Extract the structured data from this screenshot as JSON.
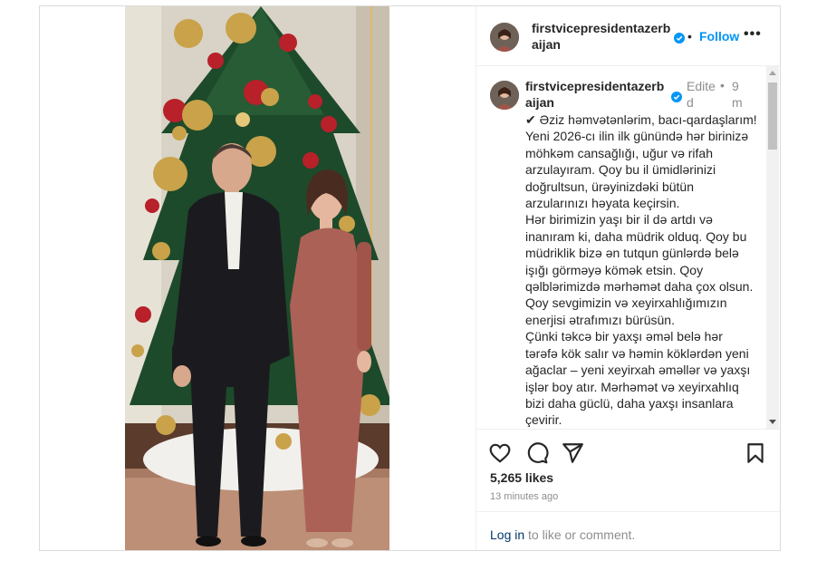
{
  "post": {
    "username": "firstvicepresidentazerbaijan",
    "follow_label": "Follow",
    "header_dot": "•",
    "more_icon": "more-horizontal-icon",
    "caption": {
      "username": "firstvicepresidentazerbaijan",
      "edited": "Edited",
      "dot": "•",
      "time": "9m",
      "text": "✔ Əziz həmvətənlərim, bacı-qardaşlarım!\nYeni 2026-cı ilin ilk günündə hər birinizə möhkəm cansağlığı, uğur və rifah arzulayıram. Qoy bu il ümidlərinizi doğrultsun, ürəyinizdəki bütün arzularınızı həyata keçirsin.\nHər birimizin yaşı bir il də artdı və inanıram ki, daha müdrik olduq. Qoy bu müdriklik bizə ən tutqun günlərdə belə işığı görməyə kömək etsin. Qoy qəlblərimizdə mərhəmət daha çox olsun. Qoy sevgimizin və xeyirxahlığımızın enerjisi ətrafımızı bürüsün.\nÇünki təkcə bir yaxşı əməl belə hər tərəfə kök salır və həmin köklərdən yeni ağaclar – yeni xeyirxah əməllər və yaxşı işlər boy atır. Mərhəmət və xeyirxahlıq bizi daha güclü, daha yaxşı insanlara çevirir."
    },
    "likes": "5,265 likes",
    "time_ago": "13 minutes ago",
    "login_link": "Log in",
    "login_rest": " to like or comment.",
    "icons": [
      "heart-icon",
      "comment-icon",
      "share-icon",
      "bookmark-icon"
    ],
    "colors": {
      "link_blue": "#0095f6",
      "verified_blue": "#0095f6",
      "muted": "#8e8e8e"
    }
  }
}
